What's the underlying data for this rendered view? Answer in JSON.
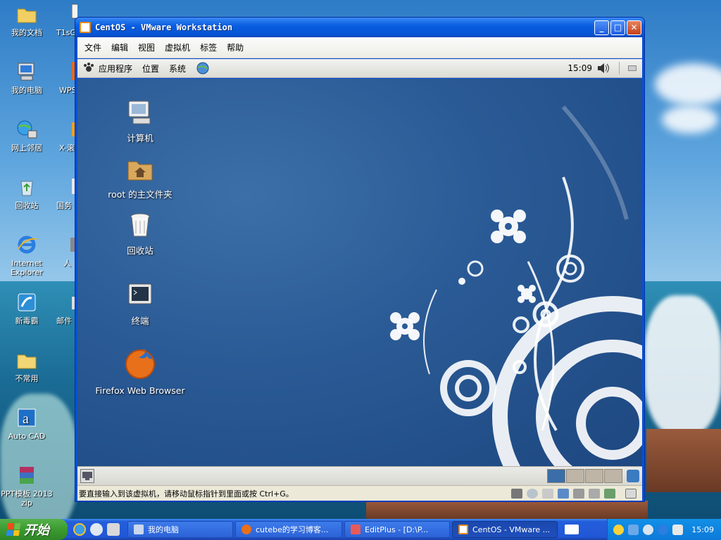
{
  "desktop": {
    "icons": [
      {
        "label": "我的文档"
      },
      {
        "label": "我的电脑"
      },
      {
        "label": "网上邻居"
      },
      {
        "label": "回收站"
      },
      {
        "label": "Internet Explorer"
      },
      {
        "label": "新毒霸"
      },
      {
        "label": "不常用"
      },
      {
        "label": "Auto CAD"
      },
      {
        "label": "PPT模板 2013 zip"
      }
    ],
    "partial_icons": [
      {
        "label": "T1sG"
      },
      {
        "label": "WPS"
      },
      {
        "label": "X-滚"
      },
      {
        "label": "国务 关于"
      },
      {
        "label": "人"
      },
      {
        "label": "邮件"
      }
    ]
  },
  "vmware": {
    "title": "CentOS - VMware Workstation",
    "menu": [
      "文件",
      "编辑",
      "视图",
      "虚拟机",
      "标签",
      "帮助"
    ],
    "status_message": "要直接输入到该虚拟机，请移动鼠标指针到里面或按 Ctrl+G。"
  },
  "guest": {
    "panel_menus": [
      "应用程序",
      "位置",
      "系统"
    ],
    "clock": "15:09",
    "icons": [
      {
        "label": "计算机"
      },
      {
        "label": "root 的主文件夹"
      },
      {
        "label": "回收站"
      },
      {
        "label": "终端"
      },
      {
        "label": "Firefox Web Browser"
      }
    ]
  },
  "taskbar": {
    "start_label": "开始",
    "tasks": [
      {
        "label": "我的电脑"
      },
      {
        "label": "cutebe的学习博客..."
      },
      {
        "label": "EditPlus - [D:\\P..."
      },
      {
        "label": "CentOS - VMware ..."
      }
    ],
    "clock": "15:09"
  }
}
